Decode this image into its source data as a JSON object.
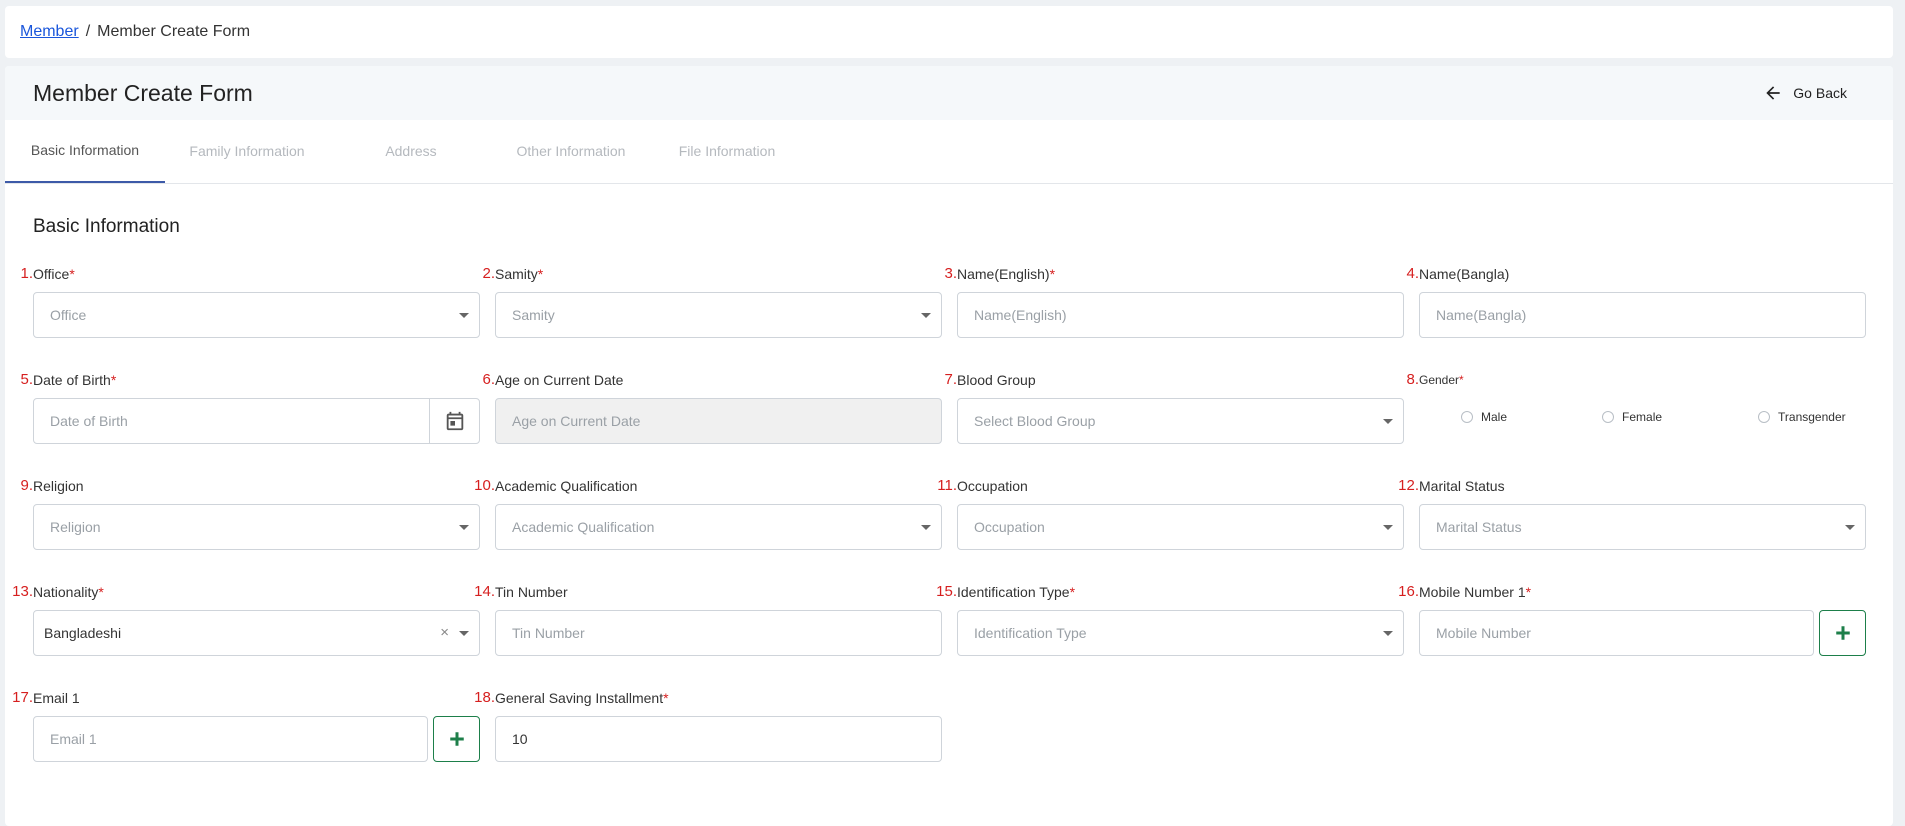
{
  "breadcrumb": {
    "parent": "Member",
    "separator": "/",
    "current": "Member Create Form"
  },
  "header": {
    "title": "Member Create Form",
    "go_back": "Go Back"
  },
  "tabs": [
    {
      "label": "Basic Information"
    },
    {
      "label": "Family Information"
    },
    {
      "label": "Address"
    },
    {
      "label": "Other Information"
    },
    {
      "label": "File Information"
    }
  ],
  "section_title": "Basic Information",
  "required_mark": "*",
  "fields": {
    "office": {
      "num": "1.",
      "label": "Office",
      "placeholder": "Office"
    },
    "samity": {
      "num": "2.",
      "label": "Samity",
      "placeholder": "Samity"
    },
    "name_en": {
      "num": "3.",
      "label": "Name(English)",
      "placeholder": "Name(English)"
    },
    "name_bn": {
      "num": "4.",
      "label": "Name(Bangla)",
      "placeholder": "Name(Bangla)"
    },
    "dob": {
      "num": "5.",
      "label": "Date of Birth",
      "placeholder": "Date of Birth"
    },
    "age": {
      "num": "6.",
      "label": "Age on Current Date",
      "placeholder": "Age on Current Date"
    },
    "blood": {
      "num": "7.",
      "label": "Blood Group",
      "placeholder": "Select Blood Group"
    },
    "gender": {
      "num": "8.",
      "label": "Gender",
      "options": [
        "Male",
        "Female",
        "Transgender"
      ]
    },
    "religion": {
      "num": "9.",
      "label": "Religion",
      "placeholder": "Religion"
    },
    "academic": {
      "num": "10.",
      "label": "Academic Qualification",
      "placeholder": "Academic Qualification"
    },
    "occupation": {
      "num": "11.",
      "label": "Occupation",
      "placeholder": "Occupation"
    },
    "marital": {
      "num": "12.",
      "label": "Marital Status",
      "placeholder": "Marital Status"
    },
    "nationality": {
      "num": "13.",
      "label": "Nationality",
      "value": "Bangladeshi",
      "clear": "×"
    },
    "tin": {
      "num": "14.",
      "label": "Tin Number",
      "placeholder": "Tin Number"
    },
    "id_type": {
      "num": "15.",
      "label": "Identification Type",
      "placeholder": "Identification Type"
    },
    "mobile": {
      "num": "16.",
      "label": "Mobile Number 1",
      "placeholder": "Mobile Number"
    },
    "email": {
      "num": "17.",
      "label": "Email 1",
      "placeholder": "Email 1"
    },
    "saving": {
      "num": "18.",
      "label": "General Saving Installment",
      "value": "10"
    }
  },
  "colors": {
    "required": "#d61f1f",
    "link": "#1a56db",
    "tab_active": "#3d5aa8",
    "plus_button": "#1d7f4a"
  }
}
